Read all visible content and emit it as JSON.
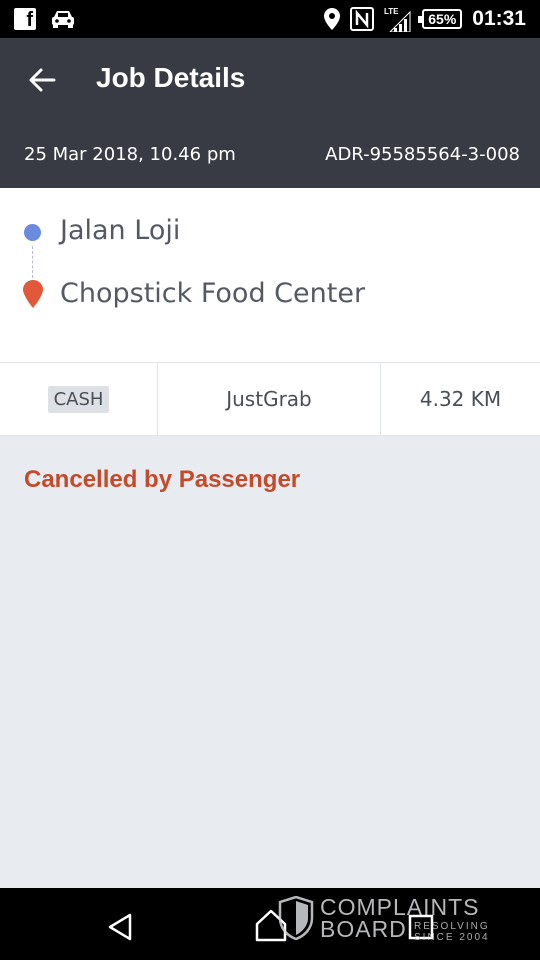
{
  "status_bar": {
    "icons": [
      "facebook-icon",
      "car-icon",
      "location-pin-icon",
      "nfc-icon",
      "lte-signal-icon",
      "battery-icon"
    ],
    "network": "LTE",
    "battery": "65%",
    "time": "01:31"
  },
  "header": {
    "back_icon": "back-arrow-icon",
    "title": "Job Details",
    "date": "25 Mar 2018, 10.46 pm",
    "job_id": "ADR-95585564-3-008"
  },
  "route": {
    "pickup": "Jalan Loji",
    "dropoff": "Chopstick Food Center"
  },
  "info": {
    "payment": "CASH",
    "service": "JustGrab",
    "distance": "4.32 KM"
  },
  "status_message": "Cancelled by Passenger",
  "nav_bar": {
    "icons": [
      "nav-back-icon",
      "nav-home-icon",
      "nav-recent-apps-icon"
    ]
  },
  "watermark": {
    "brand_line1": "COMPLAINTS",
    "brand_line2": "BOARD",
    "tagline_line1": "RESOLVING",
    "tagline_line2": "SINCE 2004"
  },
  "colors": {
    "header_bg": "#383b44",
    "pickup_dot": "#6b8bdf",
    "dropoff_pin": "#e2583a",
    "status_text": "#c54a2b",
    "content_bg": "#e8ebef"
  }
}
